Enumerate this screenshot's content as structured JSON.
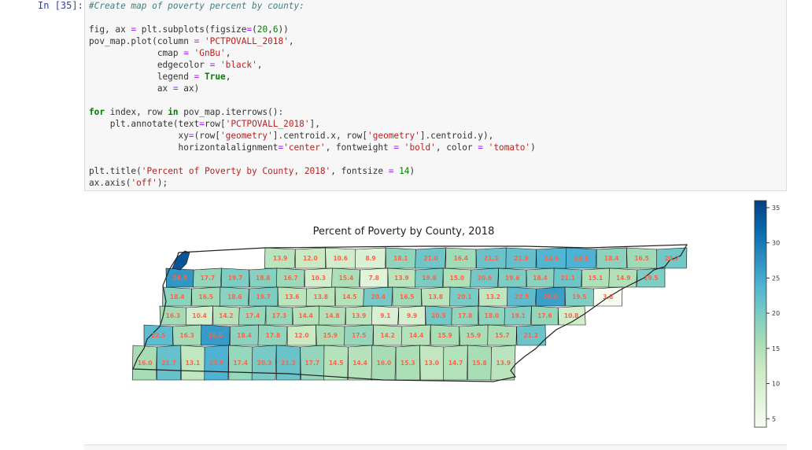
{
  "cell": {
    "prompt": "In [35]:",
    "code_lines": [
      [
        {
          "t": "#Create map of poverty percent by county:",
          "c": "cmt"
        }
      ],
      [],
      [
        {
          "t": "fig, ax "
        },
        {
          "t": "=",
          "c": "op"
        },
        {
          "t": " plt.subplots(figsize"
        },
        {
          "t": "=",
          "c": "op"
        },
        {
          "t": "("
        },
        {
          "t": "20",
          "c": "num"
        },
        {
          "t": ","
        },
        {
          "t": "6",
          "c": "num"
        },
        {
          "t": "))"
        }
      ],
      [
        {
          "t": "pov_map.plot(column "
        },
        {
          "t": "=",
          "c": "op"
        },
        {
          "t": " "
        },
        {
          "t": "'PCTPOVALL_2018'",
          "c": "str"
        },
        {
          "t": ","
        }
      ],
      [
        {
          "t": "             cmap "
        },
        {
          "t": "=",
          "c": "op"
        },
        {
          "t": " "
        },
        {
          "t": "'GnBu'",
          "c": "str"
        },
        {
          "t": ","
        }
      ],
      [
        {
          "t": "             edgecolor "
        },
        {
          "t": "=",
          "c": "op"
        },
        {
          "t": " "
        },
        {
          "t": "'black'",
          "c": "str"
        },
        {
          "t": ","
        }
      ],
      [
        {
          "t": "             legend "
        },
        {
          "t": "=",
          "c": "op"
        },
        {
          "t": " "
        },
        {
          "t": "True",
          "c": "kw"
        },
        {
          "t": ","
        }
      ],
      [
        {
          "t": "             ax "
        },
        {
          "t": "=",
          "c": "op"
        },
        {
          "t": " ax)"
        }
      ],
      [],
      [
        {
          "t": "for",
          "c": "kw"
        },
        {
          "t": " index, row "
        },
        {
          "t": "in",
          "c": "kw"
        },
        {
          "t": " pov_map.iterrows():"
        }
      ],
      [
        {
          "t": "    plt.annotate(text"
        },
        {
          "t": "=",
          "c": "op"
        },
        {
          "t": "row["
        },
        {
          "t": "'PCTPOVALL_2018'",
          "c": "str"
        },
        {
          "t": "],"
        }
      ],
      [
        {
          "t": "                 xy"
        },
        {
          "t": "=",
          "c": "op"
        },
        {
          "t": "(row["
        },
        {
          "t": "'geometry'",
          "c": "str"
        },
        {
          "t": "].centroid.x, row["
        },
        {
          "t": "'geometry'",
          "c": "str"
        },
        {
          "t": "].centroid.y),"
        }
      ],
      [
        {
          "t": "                 horizontalalignment"
        },
        {
          "t": "=",
          "c": "op"
        },
        {
          "t": "'center'",
          "c": "str"
        },
        {
          "t": ", fontweight "
        },
        {
          "t": "=",
          "c": "op"
        },
        {
          "t": " "
        },
        {
          "t": "'bold'",
          "c": "str"
        },
        {
          "t": ", color "
        },
        {
          "t": "=",
          "c": "op"
        },
        {
          "t": " "
        },
        {
          "t": "'tomato'",
          "c": "str"
        },
        {
          "t": ")"
        }
      ],
      [],
      [
        {
          "t": "plt.title("
        },
        {
          "t": "'Percent of Poverty by County, 2018'",
          "c": "str"
        },
        {
          "t": ", fontsize "
        },
        {
          "t": "=",
          "c": "op"
        },
        {
          "t": " "
        },
        {
          "t": "14",
          "c": "num"
        },
        {
          "t": ")"
        }
      ],
      [
        {
          "t": "ax.axis("
        },
        {
          "t": "'off'",
          "c": "str"
        },
        {
          "t": ");"
        }
      ]
    ]
  },
  "output": {
    "title": "Percent of Poverty by County, 2018",
    "colorbar": {
      "ticks": [
        "35",
        "30",
        "25",
        "20",
        "15",
        "10",
        "5"
      ],
      "tick_values": [
        35,
        30,
        25,
        20,
        15,
        10,
        5
      ],
      "vmin": 3.8,
      "vmax": 36.0,
      "cmap": "GnBu",
      "colors": [
        "#f7fcf0",
        "#e0f3db",
        "#ccebc5",
        "#a8ddb5",
        "#7bccc4",
        "#4eb3d3",
        "#2b8cbe",
        "#0868ac",
        "#084081"
      ]
    },
    "annotation_color": "#ff6347",
    "counties": [
      {
        "label": "13.9",
        "v": 13.9
      },
      {
        "label": "12.0",
        "v": 12.0
      },
      {
        "label": "10.6",
        "v": 10.6
      },
      {
        "label": "8.9",
        "v": 8.9
      },
      {
        "label": "18.1",
        "v": 18.1
      },
      {
        "label": "21.0",
        "v": 21.0
      },
      {
        "label": "16.4",
        "v": 16.4
      },
      {
        "label": "21.3",
        "v": 21.3
      },
      {
        "label": "21.9",
        "v": 21.9
      },
      {
        "label": "23.6",
        "v": 23.6
      },
      {
        "label": "23.9",
        "v": 23.9
      },
      {
        "label": "18.4",
        "v": 18.4
      },
      {
        "label": "16.5",
        "v": 16.5
      },
      {
        "label": "20.7",
        "v": 20.7
      },
      {
        "label": "26.9",
        "v": 26.9
      },
      {
        "label": "17.7",
        "v": 17.7
      },
      {
        "label": "19.7",
        "v": 19.7
      },
      {
        "label": "18.8",
        "v": 18.8
      },
      {
        "label": "16.7",
        "v": 16.7
      },
      {
        "label": "10.3",
        "v": 10.3
      },
      {
        "label": "15.4",
        "v": 15.4
      },
      {
        "label": "7.8",
        "v": 7.8
      },
      {
        "label": "13.9",
        "v": 13.9
      },
      {
        "label": "19.8",
        "v": 19.8
      },
      {
        "label": "15.0",
        "v": 15.0
      },
      {
        "label": "20.6",
        "v": 20.6
      },
      {
        "label": "19.6",
        "v": 19.6
      },
      {
        "label": "18.4",
        "v": 18.4
      },
      {
        "label": "21.1",
        "v": 21.1
      },
      {
        "label": "15.1",
        "v": 15.1
      },
      {
        "label": "14.9",
        "v": 14.9
      },
      {
        "label": "19.5",
        "v": 19.5
      },
      {
        "label": "18.4",
        "v": 18.4
      },
      {
        "label": "16.5",
        "v": 16.5
      },
      {
        "label": "18.6",
        "v": 18.6
      },
      {
        "label": "19.7",
        "v": 19.7
      },
      {
        "label": "13.6",
        "v": 13.6
      },
      {
        "label": "13.8",
        "v": 13.8
      },
      {
        "label": "14.5",
        "v": 14.5
      },
      {
        "label": "20.4",
        "v": 20.4
      },
      {
        "label": "16.5",
        "v": 16.5
      },
      {
        "label": "13.8",
        "v": 13.8
      },
      {
        "label": "20.1",
        "v": 20.1
      },
      {
        "label": "13.2",
        "v": 13.2
      },
      {
        "label": "22.5",
        "v": 22.5
      },
      {
        "label": "26.0",
        "v": 26.0
      },
      {
        "label": "19.5",
        "v": 19.5
      },
      {
        "label": "3.8",
        "v": 3.8
      },
      {
        "label": "16.3",
        "v": 16.3
      },
      {
        "label": "10.4",
        "v": 10.4
      },
      {
        "label": "14.2",
        "v": 14.2
      },
      {
        "label": "17.4",
        "v": 17.4
      },
      {
        "label": "17.3",
        "v": 17.3
      },
      {
        "label": "14.4",
        "v": 14.4
      },
      {
        "label": "14.8",
        "v": 14.8
      },
      {
        "label": "13.9",
        "v": 13.9
      },
      {
        "label": "9.1",
        "v": 9.1
      },
      {
        "label": "9.9",
        "v": 9.9
      },
      {
        "label": "20.5",
        "v": 20.5
      },
      {
        "label": "17.8",
        "v": 17.8
      },
      {
        "label": "18.0",
        "v": 18.0
      },
      {
        "label": "19.1",
        "v": 19.1
      },
      {
        "label": "17.6",
        "v": 17.6
      },
      {
        "label": "10.8",
        "v": 10.8
      },
      {
        "label": "22.5",
        "v": 22.5
      },
      {
        "label": "16.3",
        "v": 16.3
      },
      {
        "label": "26.5",
        "v": 26.5
      },
      {
        "label": "18.4",
        "v": 18.4
      },
      {
        "label": "17.8",
        "v": 17.8
      },
      {
        "label": "12.0",
        "v": 12.0
      },
      {
        "label": "15.9",
        "v": 15.9
      },
      {
        "label": "17.5",
        "v": 17.5
      },
      {
        "label": "14.2",
        "v": 14.2
      },
      {
        "label": "14.4",
        "v": 14.4
      },
      {
        "label": "15.9",
        "v": 15.9
      },
      {
        "label": "15.9",
        "v": 15.9
      },
      {
        "label": "15.7",
        "v": 15.7
      },
      {
        "label": "21.2",
        "v": 21.2
      },
      {
        "label": "16.0",
        "v": 16.0
      },
      {
        "label": "21.7",
        "v": 21.7
      },
      {
        "label": "13.1",
        "v": 13.1
      },
      {
        "label": "23.9",
        "v": 23.9
      },
      {
        "label": "17.4",
        "v": 17.4
      },
      {
        "label": "20.3",
        "v": 20.3
      },
      {
        "label": "21.3",
        "v": 21.3
      },
      {
        "label": "17.7",
        "v": 17.7
      },
      {
        "label": "14.5",
        "v": 14.5
      },
      {
        "label": "14.4",
        "v": 14.4
      },
      {
        "label": "16.0",
        "v": 16.0
      },
      {
        "label": "15.3",
        "v": 15.3
      },
      {
        "label": "13.0",
        "v": 13.0
      },
      {
        "label": "14.7",
        "v": 14.7
      },
      {
        "label": "15.8",
        "v": 15.8
      },
      {
        "label": "13.9",
        "v": 13.9
      }
    ]
  }
}
